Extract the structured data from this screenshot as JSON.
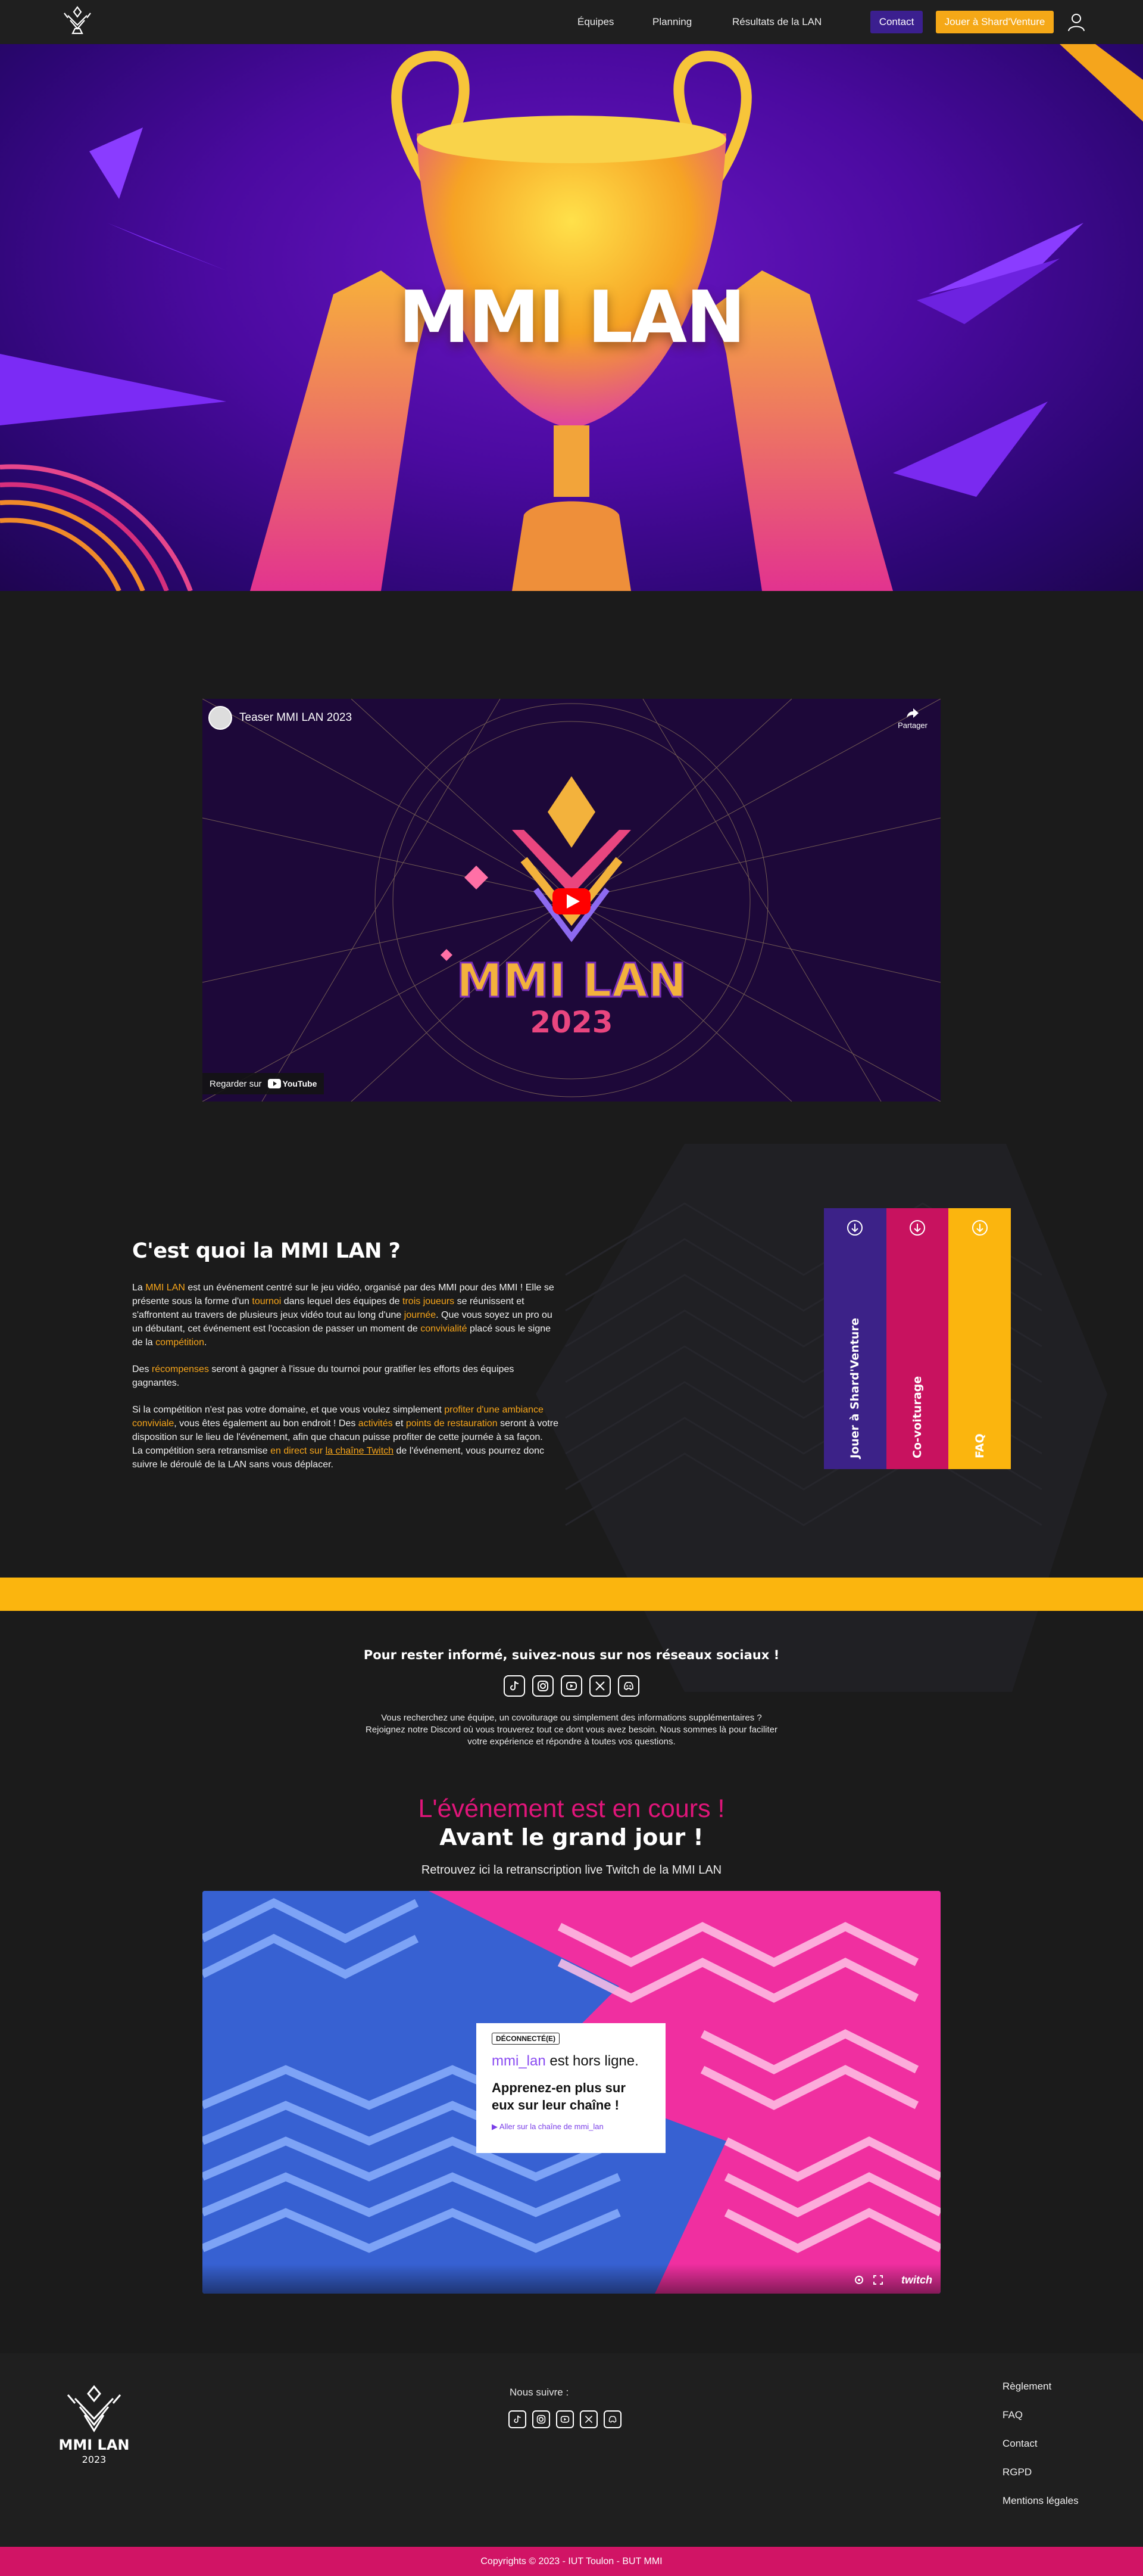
{
  "nav": {
    "links": [
      "Équipes",
      "Planning",
      "Résultats de la LAN"
    ],
    "contact": "Contact",
    "play": "Jouer à Shard'Venture"
  },
  "hero": {
    "title": "MMI LAN"
  },
  "video": {
    "title": "Teaser MMI LAN 2023",
    "share": "Partager",
    "watch_on": "Regarder sur",
    "youtube": "YouTube",
    "logo_text": "MMI LAN",
    "logo_year": "2023"
  },
  "about": {
    "title": "C'est quoi la MMI LAN ?",
    "p1": [
      {
        "t": "La "
      },
      {
        "t": "MMI LAN",
        "hl": true
      },
      {
        "t": " est un événement centré sur le jeu vidéo, organisé par des MMI pour des MMI ! Elle se présente sous la forme d'un "
      },
      {
        "t": "tournoi",
        "hl": true
      },
      {
        "t": " dans lequel des équipes de "
      },
      {
        "t": "trois joueurs",
        "hl": true
      },
      {
        "t": " se réunissent et s'affrontent au travers de plusieurs jeux vidéo tout au long d'une "
      },
      {
        "t": "journée",
        "hl": true
      },
      {
        "t": ". Que vous soyez un pro ou un débutant, cet événement est l'occasion de passer un moment de "
      },
      {
        "t": "convivialité",
        "hl": true
      },
      {
        "t": " placé sous le signe de la "
      },
      {
        "t": "compétition",
        "hl": true
      },
      {
        "t": "."
      }
    ],
    "p2": [
      {
        "t": "Des "
      },
      {
        "t": "récompenses",
        "hl": true
      },
      {
        "t": " seront à gagner à l'issue du tournoi pour gratifier les efforts des équipes gagnantes."
      }
    ],
    "p3": [
      {
        "t": "Si la compétition n'est pas votre domaine, et que vous voulez simplement "
      },
      {
        "t": "profiter d'une ambiance conviviale",
        "hl": true
      },
      {
        "t": ", vous êtes également au bon endroit ! Des "
      },
      {
        "t": "activités",
        "hl": true
      },
      {
        "t": " et "
      },
      {
        "t": "points de restauration",
        "hl": true
      },
      {
        "t": " seront à votre disposition sur le lieu de l'événement, afin que chacun puisse profiter de cette journée à sa façon."
      }
    ],
    "p4": [
      {
        "t": "La compétition sera retransmise "
      },
      {
        "t": "en direct sur ",
        "hl": true
      },
      {
        "t": "la chaîne Twitch",
        "hl": true,
        "u": true
      },
      {
        "t": " de l'événement, vous pourrez donc suivre le déroulé de la LAN sans vous déplacer."
      }
    ]
  },
  "cards": [
    {
      "label": "Jouer à Shard'Venture",
      "color": "#3c2288"
    },
    {
      "label": "Co-voiturage",
      "color": "#c8125f"
    },
    {
      "label": "FAQ",
      "color": "#fbb50e"
    }
  ],
  "social": {
    "title": "Pour rester informé, suivez-nous sur nos réseaux sociaux !",
    "info": "Vous recherchez une équipe, un covoiturage ou simplement des informations supplémentaires ? Rejoignez notre Discord où vous trouverez tout ce dont vous avez besoin. Nous sommes là pour faciliter votre expérience et répondre à toutes vos questions.",
    "icons": [
      "tiktok-icon",
      "instagram-icon",
      "youtube-icon",
      "x-icon",
      "discord-icon"
    ]
  },
  "live": {
    "status": "L'événement est en cours !",
    "headline": "Avant le grand jour !",
    "subtitle": "Retrouvez ici la retranscription live Twitch de la MMI LAN"
  },
  "twitch": {
    "tag": "DÉCONNECTÉ(E)",
    "channel": "mmi_lan",
    "offline": " est hors ligne.",
    "learn": "Apprenez-en plus sur eux sur leur chaîne !",
    "link": "Aller sur la chaîne de mmi_lan",
    "brand": "twitch"
  },
  "footer": {
    "follow": "Nous suivre :",
    "links": [
      "Règlement",
      "FAQ",
      "Contact",
      "RGPD",
      "Mentions légales"
    ],
    "logo_text": "MMI LAN",
    "logo_year": "2023",
    "copyright": "Copyrights © 2023 - IUT Toulon - BUT MMI"
  },
  "colors": {
    "accent_yellow": "#fbb50e",
    "accent_pink": "#d11465",
    "accent_purple": "#3c2288",
    "background": "#1b1b1b"
  }
}
